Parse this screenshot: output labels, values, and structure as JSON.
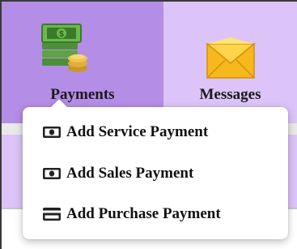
{
  "colors": {
    "active_tab_bg": "#b48de6",
    "inactive_tab_bg": "#dcc4f8",
    "dropdown_bg": "#ffffff",
    "text": "#111111"
  },
  "nav": {
    "items": [
      {
        "label": "Payments",
        "icon": "money-stack-icon",
        "active": true
      },
      {
        "label": "Messages",
        "icon": "envelope-icon",
        "active": false
      }
    ]
  },
  "dropdown": {
    "items": [
      {
        "label": "Add Service Payment",
        "icon": "cash-note-icon"
      },
      {
        "label": "Add Sales Payment",
        "icon": "cash-note-icon"
      },
      {
        "label": "Add Purchase Payment",
        "icon": "credit-card-icon"
      }
    ]
  }
}
